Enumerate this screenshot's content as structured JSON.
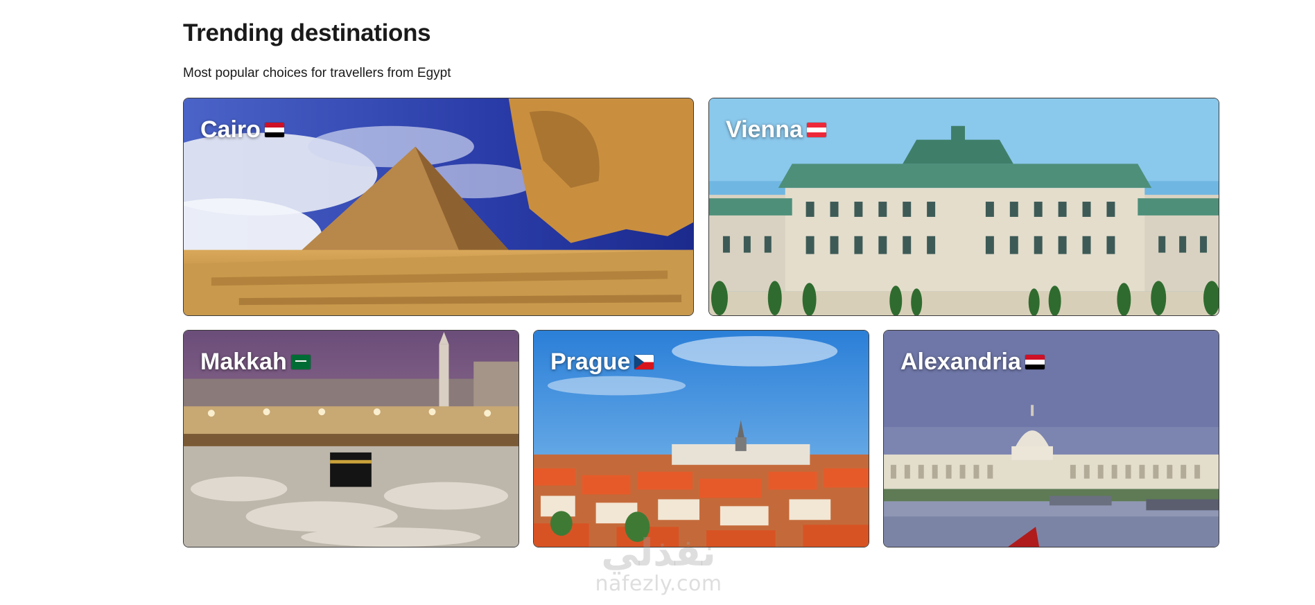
{
  "section": {
    "title": "Trending destinations",
    "subtitle": "Most popular choices for travellers from Egypt"
  },
  "destinations": [
    {
      "name": "Cairo",
      "flag_icon": "egypt-flag-icon"
    },
    {
      "name": "Vienna",
      "flag_icon": "austria-flag-icon"
    },
    {
      "name": "Makkah",
      "flag_icon": "saudi-arabia-flag-icon"
    },
    {
      "name": "Prague",
      "flag_icon": "czech-republic-flag-icon"
    },
    {
      "name": "Alexandria",
      "flag_icon": "egypt-flag-icon"
    }
  ],
  "watermark": {
    "arabic": "نفذلي",
    "latin": "nafezly.com"
  }
}
